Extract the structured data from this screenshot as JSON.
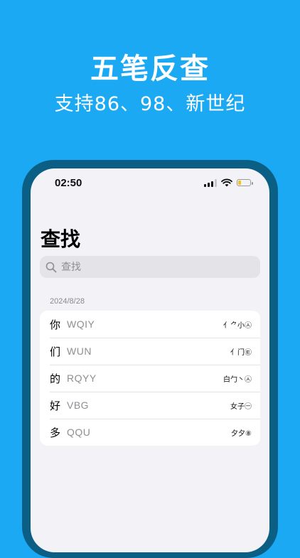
{
  "hero": {
    "title": "五笔反查",
    "subtitle": "支持86、98、新世纪"
  },
  "status_bar": {
    "time": "02:50",
    "battery_level": 0.2,
    "colors": {
      "battery": "#f4c21a"
    }
  },
  "page": {
    "title": "查找"
  },
  "search": {
    "placeholder": "查找"
  },
  "history": {
    "date": "2024/8/28",
    "entries": [
      {
        "char": "你",
        "code": "WQIY",
        "roots": "亻⺈小㉦"
      },
      {
        "char": "们",
        "code": "WUN",
        "roots": "亻门㉫"
      },
      {
        "char": "的",
        "code": "RQYY",
        "roots": "白勹丶㉦"
      },
      {
        "char": "好",
        "code": "VBG",
        "roots": "女子㊀"
      },
      {
        "char": "多",
        "code": "QQU",
        "roots": "夕夕⑧"
      }
    ]
  },
  "colors": {
    "background": "#1ca9f4",
    "phone_frame": "#0b5f84",
    "screen": "#f2f2f7"
  }
}
